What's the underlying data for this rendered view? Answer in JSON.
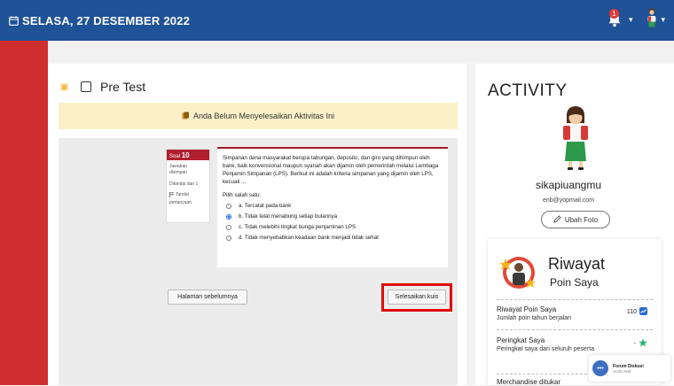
{
  "header": {
    "date": "SELASA, 27 DESEMBER 2022",
    "notification_count": "1",
    "bg_color": "#1f5297"
  },
  "quiz": {
    "title": "Pre Test",
    "notice": "Anda Belum Menyelesaikan Aktivitas Ini",
    "nav": {
      "soal_label": "Soal",
      "soal_number": "10",
      "line1": "Jawaban",
      "line2": "disimpan",
      "line3": "Ditandai dari 1",
      "line4": "Tandai",
      "line5": "pertanyaan"
    },
    "question": "Simpanan dana masyarakat berupa tabungan, deposito, dan giro yang dihimpun oleh bank, baik konvensional maupun syariah akan dijamin oleh pemerintah melalui Lembaga Penjamin Simpanan (LPS). Berikut ini adalah kriteria simpanan yang dijamin oleh LPS, kecuali ...",
    "choose_label": "Pilih salah satu:",
    "options": [
      {
        "label": "a. Tercatat pada bank",
        "selected": false
      },
      {
        "label": "b. Tidak telat menabung setiap bulannya",
        "selected": true
      },
      {
        "label": "c. Tidak melebihi tingkat bunga penjaminan LPS",
        "selected": false
      },
      {
        "label": "d. Tidak menyebabkan keadaan bank menjadi tidak sehat",
        "selected": false
      }
    ],
    "prev_button": "Halaman sebelumnya",
    "finish_button": "Selesaikan kuis"
  },
  "activity": {
    "title": "ACTIVITY",
    "username": "sikapiuangmu",
    "email": "enb@yopmail.com",
    "change_photo": "Ubah Foto",
    "riwayat_title": "Riwayat",
    "riwayat_subtitle": "Poin Saya",
    "rows": [
      {
        "label": "Riwayat Poin Saya",
        "sub": "Jumlah poin tahun berjalan",
        "value": "110"
      },
      {
        "label": "Peringkat Saya",
        "sub": "Peringkat saya dari seluruh peserta",
        "value": "-"
      },
      {
        "label": "Merchandise ditukar",
        "sub": "",
        "value": ""
      }
    ]
  },
  "forum": {
    "title": "Forum Diskusi",
    "status": "Anda Aktif"
  }
}
